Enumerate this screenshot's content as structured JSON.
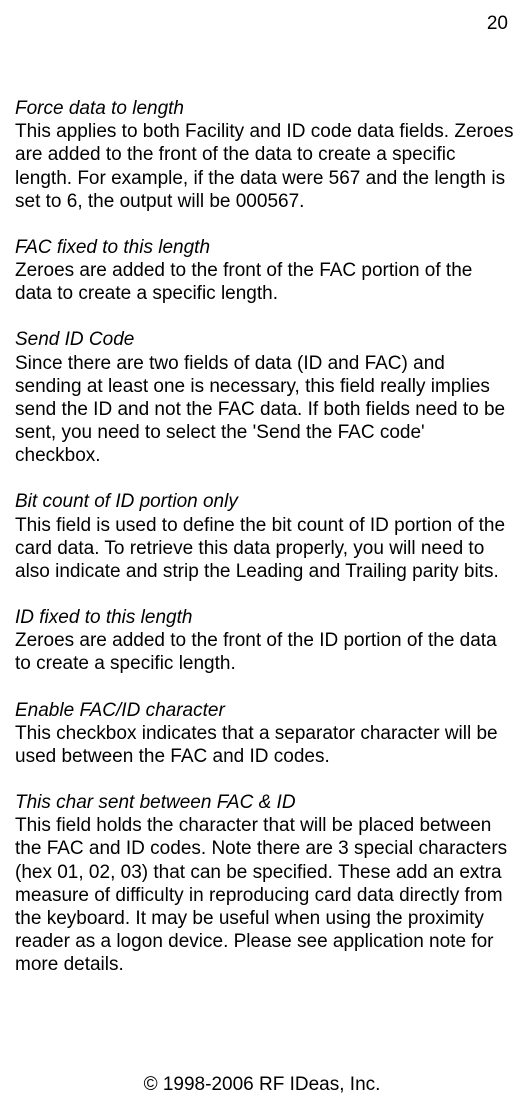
{
  "page_number": "20",
  "sections": [
    {
      "heading": "Force data to length",
      "body": "This applies to both Facility and ID code data fields.  Zeroes are added to the front of the data to create a specific length.  For example, if the data were 567 and the length is set to 6, the output will be 000567."
    },
    {
      "heading": "FAC fixed to this length",
      "body": "Zeroes are added to the front of the FAC portion of the data to create a specific length."
    },
    {
      "heading": "Send ID Code",
      "body": "Since there are two fields of data (ID and FAC) and sending at least one is necessary, this field really implies send the ID and not the FAC data.  If both fields need to be sent, you need to select the 'Send the FAC code' checkbox."
    },
    {
      "heading": "Bit count of ID portion only",
      "body": "This field is used to define the bit count of ID portion of the card data.  To retrieve this data properly, you will need to also indicate and strip the Leading and Trailing parity bits."
    },
    {
      "heading": "ID fixed to this length",
      "body": "Zeroes are added to the front of the ID portion of the data to create a specific length."
    },
    {
      "heading": "Enable FAC/ID character",
      "body": "This checkbox indicates that a separator character will be used between the FAC and ID codes."
    },
    {
      "heading": "This char sent between FAC & ID",
      "body": "This field holds the character that will be placed between the FAC and ID codes. Note there are 3 special characters (hex 01, 02, 03) that can be specified.  These add an extra measure of difficulty in reproducing card data directly from the keyboard.  It may be useful when using the proximity reader as a logon device.  Please see application note for more details."
    }
  ],
  "footer": "© 1998-2006 RF IDeas, Inc."
}
